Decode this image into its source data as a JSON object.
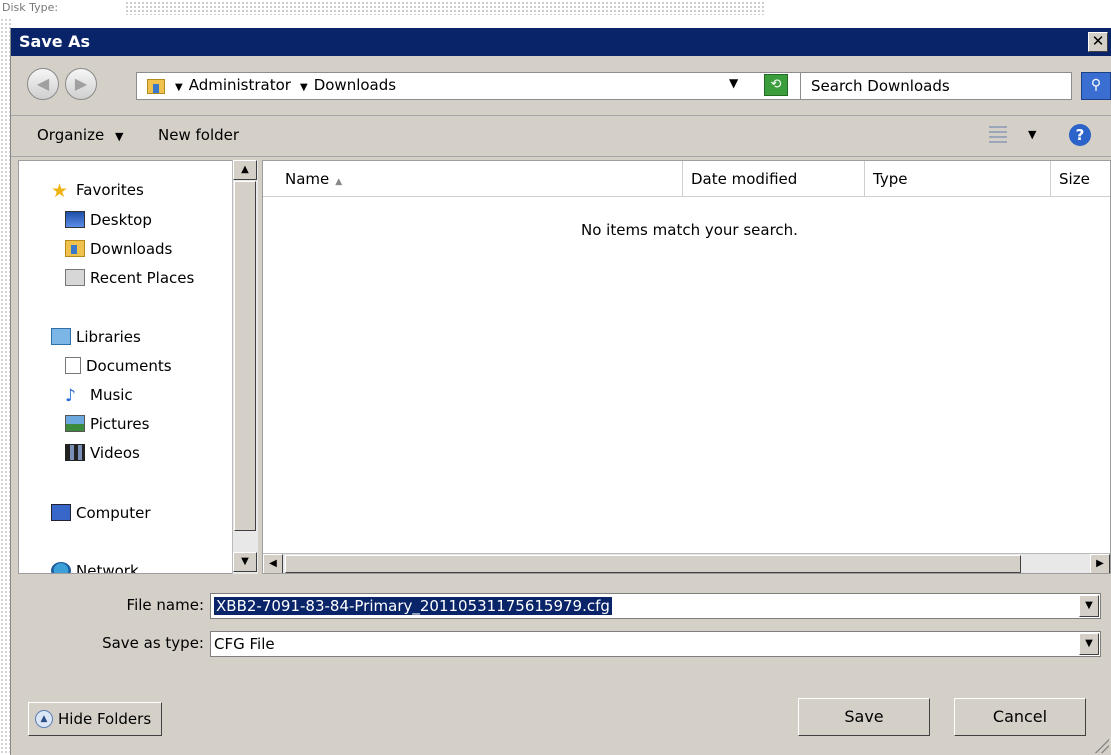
{
  "background": {
    "label": "Disk Type:"
  },
  "dialog": {
    "title": "Save As",
    "close_glyph": "✕"
  },
  "address": {
    "crumbs": [
      "Administrator",
      "Downloads"
    ],
    "search_placeholder": "Search Downloads"
  },
  "toolbar": {
    "organize_label": "Organize",
    "new_folder_label": "New folder",
    "help_glyph": "?"
  },
  "sidebar": {
    "items": [
      {
        "label": "Favorites",
        "icon": "star-icon"
      },
      {
        "label": "Desktop",
        "icon": "desktop-icon"
      },
      {
        "label": "Downloads",
        "icon": "downloads-folder-icon"
      },
      {
        "label": "Recent Places",
        "icon": "recent-places-icon"
      },
      {
        "label": "Libraries",
        "icon": "libraries-icon"
      },
      {
        "label": "Documents",
        "icon": "documents-icon"
      },
      {
        "label": "Music",
        "icon": "music-icon"
      },
      {
        "label": "Pictures",
        "icon": "pictures-icon"
      },
      {
        "label": "Videos",
        "icon": "videos-icon"
      },
      {
        "label": "Computer",
        "icon": "computer-icon"
      },
      {
        "label": "Network",
        "icon": "network-icon"
      }
    ]
  },
  "filelist": {
    "columns": [
      "Name",
      "Date modified",
      "Type",
      "Size"
    ],
    "empty_message": "No items match your search."
  },
  "form": {
    "filename_label": "File name:",
    "filename_value": "XBB2-7091-83-84-Primary_20110531175615979.cfg",
    "type_label": "Save as type:",
    "type_value": "CFG File"
  },
  "buttons": {
    "hide_folders": "Hide Folders",
    "save": "Save",
    "cancel": "Cancel"
  },
  "colors": {
    "titlebar": "#0a246a",
    "dialog_face": "#d4d0c8",
    "selection": "#0a246a"
  }
}
